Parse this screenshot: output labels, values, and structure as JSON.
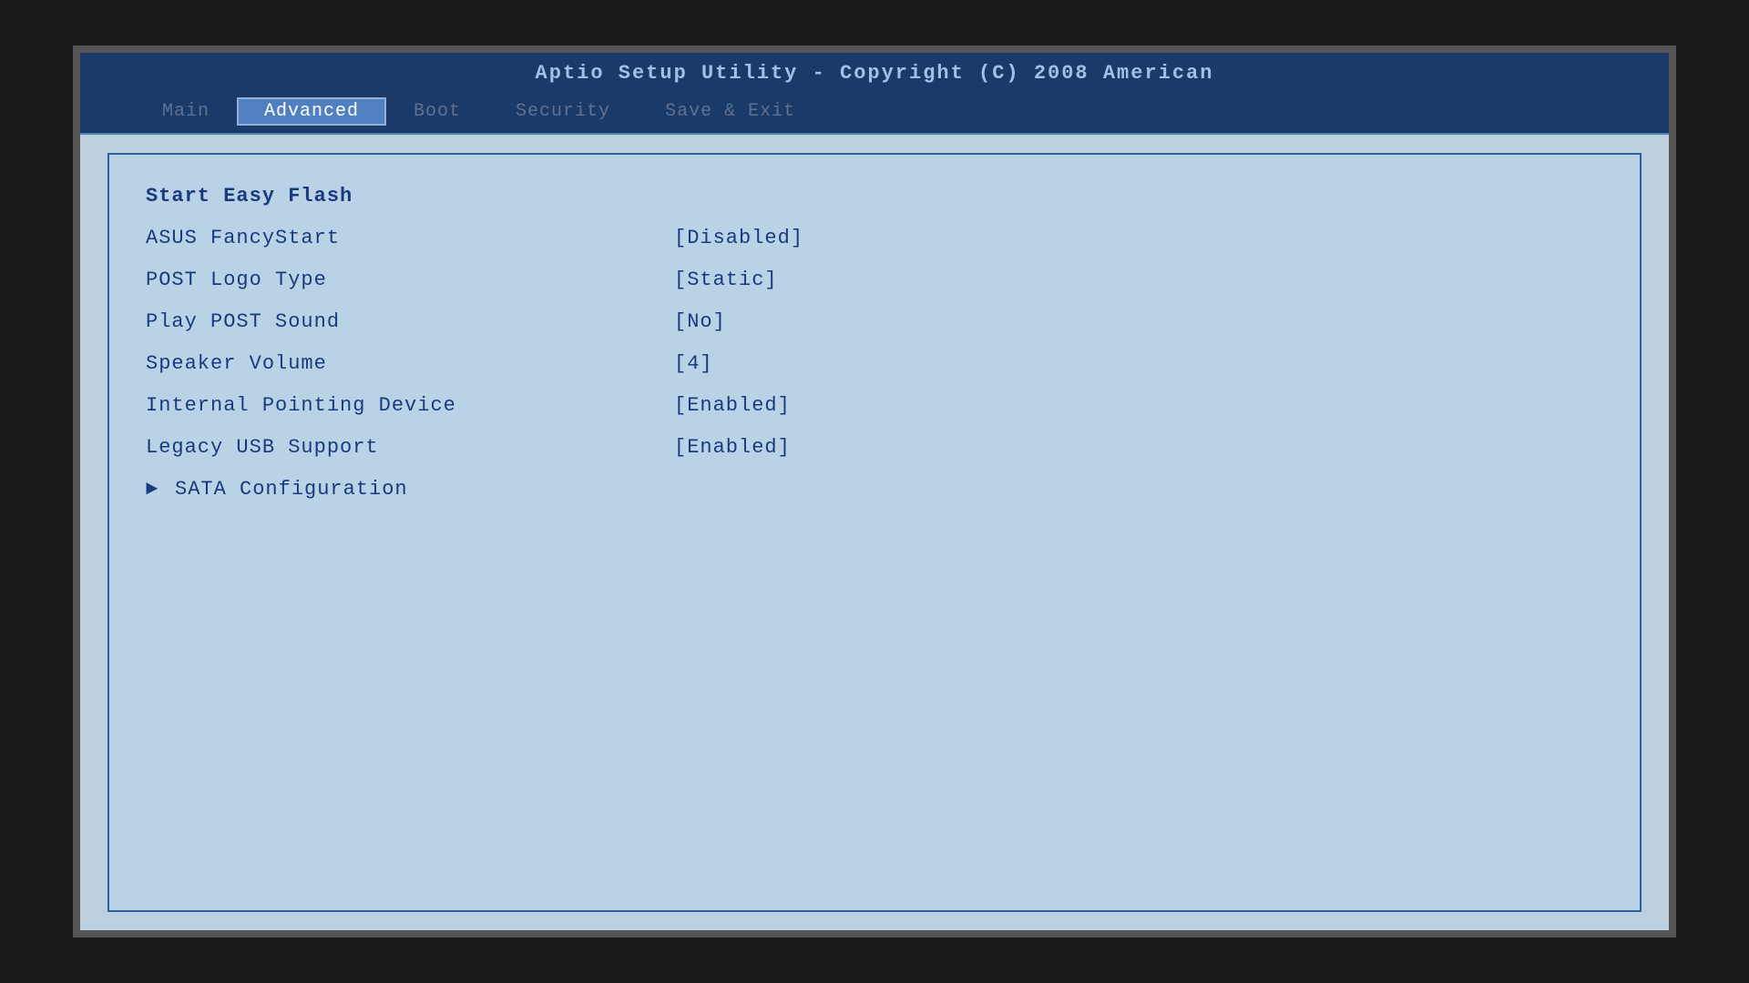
{
  "titleBar": {
    "text": "Aptio Setup Utility - Copyright (C) 2008 American"
  },
  "menuBar": {
    "items": [
      {
        "id": "main",
        "label": "Main",
        "state": "dim"
      },
      {
        "id": "advanced",
        "label": "Advanced",
        "state": "active"
      },
      {
        "id": "boot",
        "label": "Boot",
        "state": "dim"
      },
      {
        "id": "security",
        "label": "Security",
        "state": "dim"
      },
      {
        "id": "save-exit",
        "label": "Save & Exit",
        "state": "dim"
      }
    ]
  },
  "menuItems": [
    {
      "id": "start-easy-flash",
      "label": "Start Easy Flash",
      "value": "",
      "hasArrow": false
    },
    {
      "id": "asus-fancystart",
      "label": "ASUS FancyStart",
      "value": "[Disabled]",
      "hasArrow": false
    },
    {
      "id": "post-logo-type",
      "label": "POST Logo Type",
      "value": "[Static]",
      "hasArrow": false
    },
    {
      "id": "play-post-sound",
      "label": "Play POST Sound",
      "value": "[No]",
      "hasArrow": false
    },
    {
      "id": "speaker-volume",
      "label": "Speaker Volume",
      "value": "[4]",
      "hasArrow": false
    },
    {
      "id": "internal-pointing-device",
      "label": "Internal Pointing Device",
      "value": "[Enabled]",
      "hasArrow": false
    },
    {
      "id": "legacy-usb-support",
      "label": "Legacy USB Support",
      "value": "[Enabled]",
      "hasArrow": false
    },
    {
      "id": "sata-configuration",
      "label": "SATA Configuration",
      "value": "",
      "hasArrow": true
    }
  ]
}
